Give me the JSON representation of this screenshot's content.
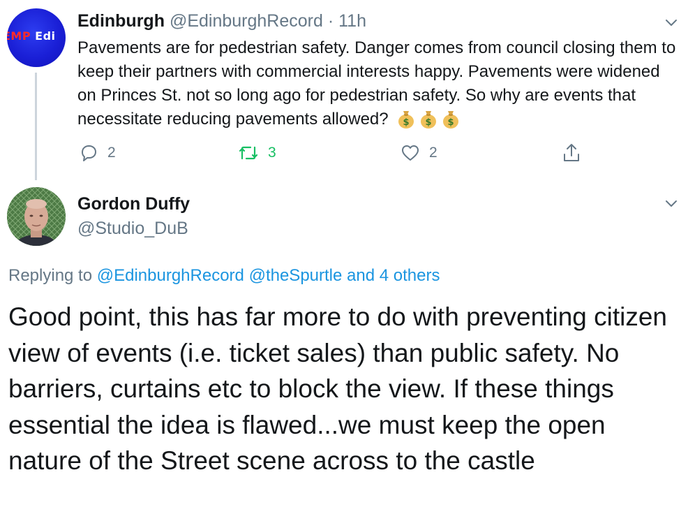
{
  "parent_tweet": {
    "display_name": "Edinburgh",
    "handle": "@EdinburghRecord",
    "separator": "·",
    "time": "11h",
    "avatar_text_left": "EMP",
    "avatar_text_right": "Edi",
    "text": "Pavements are for pedestrian safety. Danger comes from council closing them to keep their partners with commercial interests happy. Pavements were widened on Princes St. not so long ago for pedestrian safety. So why are events that necessitate reducing pavements allowed?",
    "emoji_icons": [
      "money-bag-icon",
      "money-bag-icon",
      "money-bag-icon"
    ],
    "reply_count": "2",
    "retweet_count": "3",
    "like_count": "2"
  },
  "reply_tweet": {
    "display_name": "Gordon Duffy",
    "handle": "@Studio_DuB",
    "replying_prefix": "Replying to",
    "replying_handle_1": "@EdinburghRecord",
    "replying_handle_2": "@theSpurtle",
    "replying_others": "and 4 others",
    "text": "Good point, this has far more to do with preventing citizen view of events (i.e. ticket sales) than public safety. No barriers, curtains etc to block the view. If these things essential the idea is flawed...we must keep the open nature of the Street scene across to the castle"
  },
  "colors": {
    "text_primary": "#14171a",
    "text_secondary": "#657786",
    "link": "#1b95e0",
    "retweet_active": "#17bf63",
    "avatar_blue": "#1a1fd6"
  }
}
